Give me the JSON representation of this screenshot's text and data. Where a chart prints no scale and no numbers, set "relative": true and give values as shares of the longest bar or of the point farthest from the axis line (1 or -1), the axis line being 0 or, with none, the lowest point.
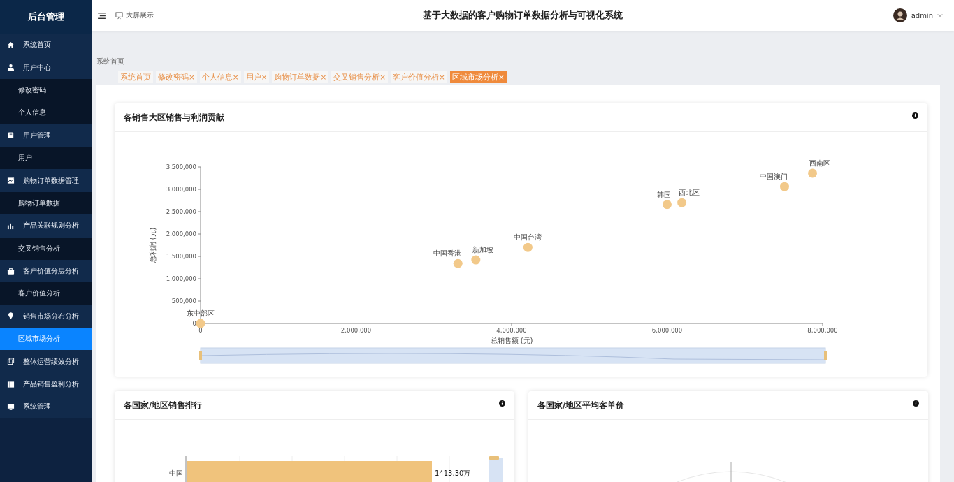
{
  "sidebar": {
    "title": "后台管理",
    "items": [
      {
        "label": "系统首页",
        "selected": false
      },
      {
        "label": "用户中心",
        "selected": false,
        "children": [
          {
            "label": "修改密码",
            "selected": false
          },
          {
            "label": "个人信息",
            "selected": false
          }
        ]
      },
      {
        "label": "用户管理",
        "selected": false,
        "children": [
          {
            "label": "用户",
            "selected": false
          }
        ]
      },
      {
        "label": "购物订单数据管理",
        "selected": false,
        "children": [
          {
            "label": "购物订单数据",
            "selected": false
          }
        ]
      },
      {
        "label": "产品关联规则分析",
        "selected": false,
        "children": [
          {
            "label": "交叉销售分析",
            "selected": false
          }
        ]
      },
      {
        "label": "客户价值分层分析",
        "selected": false,
        "children": [
          {
            "label": "客户价值分析",
            "selected": false
          }
        ]
      },
      {
        "label": "销售市场分布分析",
        "selected": false,
        "children": [
          {
            "label": "区域市场分析",
            "selected": true
          }
        ]
      },
      {
        "label": "整体运营绩效分析",
        "selected": false
      },
      {
        "label": "产品销售盈利分析",
        "selected": false
      },
      {
        "label": "系统管理",
        "selected": false
      }
    ]
  },
  "header": {
    "screen_link": "大屏展示",
    "title": "基于大数据的客户购物订单数据分析与可视化系统",
    "user": "admin"
  },
  "breadcrumb": "系统首页",
  "tabs": [
    {
      "label": "系统首页",
      "selected": false
    },
    {
      "label": "修改密码",
      "close": "×",
      "selected": false
    },
    {
      "label": "个人信息",
      "close": "×",
      "selected": false
    },
    {
      "label": "用户",
      "close": "×",
      "selected": false
    },
    {
      "label": "购物订单数据",
      "close": "×",
      "selected": false
    },
    {
      "label": "交叉销售分析",
      "close": "×",
      "selected": false
    },
    {
      "label": "客户价值分析",
      "close": "×",
      "selected": false
    },
    {
      "label": "区域市场分析",
      "close": "×",
      "selected": true
    }
  ],
  "cards": [
    {
      "title": "各销售大区销售与利润贡献",
      "chart_data": {
        "type": "scatter",
        "xlabel": "总销售额 (元)",
        "ylabel": "总利润 (元)",
        "xlim": [
          0,
          8000000
        ],
        "ylim": [
          0,
          3500000
        ],
        "xticks": [
          {
            "value": 0,
            "label": "0"
          },
          {
            "value": 2000000,
            "label": "2,000,000"
          },
          {
            "value": 4000000,
            "label": "4,000,000"
          },
          {
            "value": 6000000,
            "label": "6,000,000"
          },
          {
            "value": 8000000,
            "label": "8,000,000"
          }
        ],
        "yticks": [
          {
            "value": 0,
            "label": "0"
          },
          {
            "value": 500000,
            "label": "500,000"
          },
          {
            "value": 1000000,
            "label": "1,000,000"
          },
          {
            "value": 1500000,
            "label": "1,500,000"
          },
          {
            "value": 2000000,
            "label": "2,000,000"
          },
          {
            "value": 2500000,
            "label": "2,500,000"
          },
          {
            "value": 3000000,
            "label": "3,000,000"
          },
          {
            "value": 3500000,
            "label": "3,500,000"
          }
        ],
        "x": [
          0,
          3310000,
          3540000,
          4210000,
          6000000,
          6190000,
          7510000,
          7870000
        ],
        "series": [
          {
            "color": "#f2c98a",
            "values": [
              0,
              1340000,
              1420000,
              1700000,
              2660000,
              2700000,
              3060000,
              3360000
            ]
          }
        ],
        "annotations": [
          {
            "text": "东中部区",
            "x": 0,
            "y": 0
          },
          {
            "text": "中国香港",
            "x": 3310000,
            "y": 1340000
          },
          {
            "text": "新加坡",
            "x": 3540000,
            "y": 1420000
          },
          {
            "text": "中国台湾",
            "x": 4210000,
            "y": 1700000
          },
          {
            "text": "韩国",
            "x": 6000000,
            "y": 2660000
          },
          {
            "text": "西北区",
            "x": 6190000,
            "y": 2700000
          },
          {
            "text": "中国澳门",
            "x": 7510000,
            "y": 3060000
          },
          {
            "text": "西南区",
            "x": 7870000,
            "y": 3360000
          }
        ]
      }
    },
    {
      "title": "各国家/地区销售排行",
      "chart_data": {
        "type": "bar",
        "orientation": "horizontal",
        "relative": true,
        "categories": [
          "中国"
        ],
        "series": [
          {
            "color": "#f0c37c",
            "values": [
              1
            ]
          }
        ],
        "value_labels": [
          "1413.30万"
        ]
      }
    },
    {
      "title": "各国家/地区平均客单价"
    }
  ]
}
